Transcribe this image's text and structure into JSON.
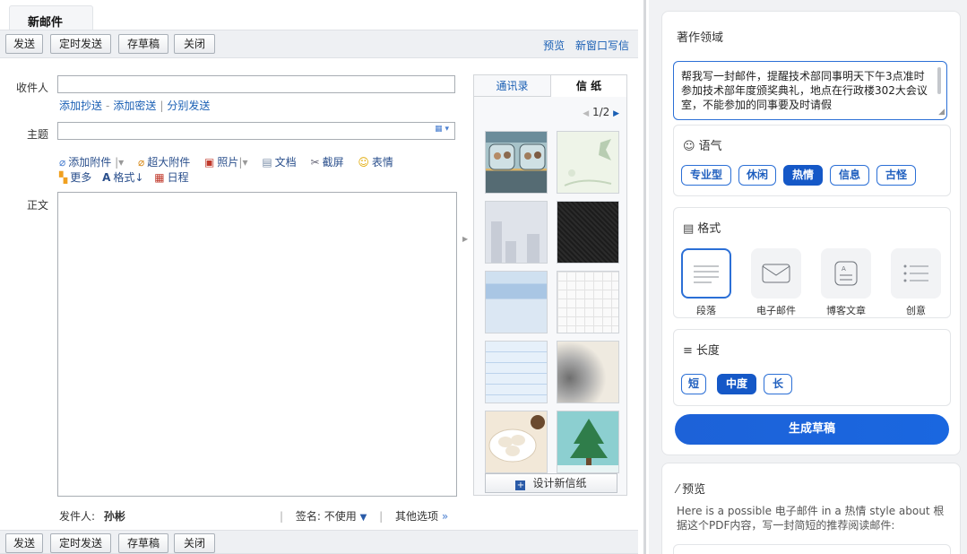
{
  "mail": {
    "tab_title": "新邮件",
    "toolbar": {
      "send": "发送",
      "scheduled_send": "定时发送",
      "save_draft": "存草稿",
      "close": "关闭"
    },
    "top_links": {
      "preview": "预览",
      "new_window": "新窗口写信"
    },
    "recipient_label": "收件人",
    "cc_links": {
      "add_cc": "添加抄送",
      "add_bcc": "添加密送",
      "separate_send": "分别发送",
      "sep1": "-",
      "sep2": "|"
    },
    "subject_label": "主题",
    "attachments": {
      "add_attachment": "添加附件",
      "large_attachment": "超大附件",
      "photo": "照片",
      "document": "文档",
      "screenshot": "截屏",
      "emoji": "表情",
      "more": "更多",
      "format": "格式",
      "schedule": "日程"
    },
    "body_label": "正文",
    "sender_label": "发件人:",
    "sender_name": "孙彬",
    "signature_label": "签名:",
    "signature_value": "不使用",
    "other_options": "其他选项",
    "sep": "|"
  },
  "letter_panel": {
    "tab_contacts": "通讯录",
    "tab_stationery": "信 纸",
    "page": "1/2",
    "design_button": "设计新信纸"
  },
  "ai": {
    "writing_field_title": "著作领域",
    "topic_text": "帮我写一封邮件，提醒技术部同事明天下午3点准时参加技术部年度颁奖典礼，地点在行政楼302大会议室，不能参加的同事要及时请假",
    "tone_title": "语气",
    "tones": [
      "专业型",
      "休闲",
      "热情",
      "信息",
      "古怪"
    ],
    "tone_selected": "热情",
    "format_title": "格式",
    "formats": [
      "段落",
      "电子邮件",
      "博客文章",
      "创意"
    ],
    "format_selected": "段落",
    "length_title": "长度",
    "lengths": [
      "短",
      "中度",
      "长"
    ],
    "length_selected": "中度",
    "generate_button": "生成草稿",
    "preview_title": "预览",
    "preview_text": "Here is a possible 电子邮件 in a 热情 style about 根据这个PDF内容，写一封简短的推荐阅读邮件:"
  },
  "colors": {
    "accent": "#1558c7",
    "link": "#1a5fb4",
    "panel_bg": "#f1f2f4"
  }
}
